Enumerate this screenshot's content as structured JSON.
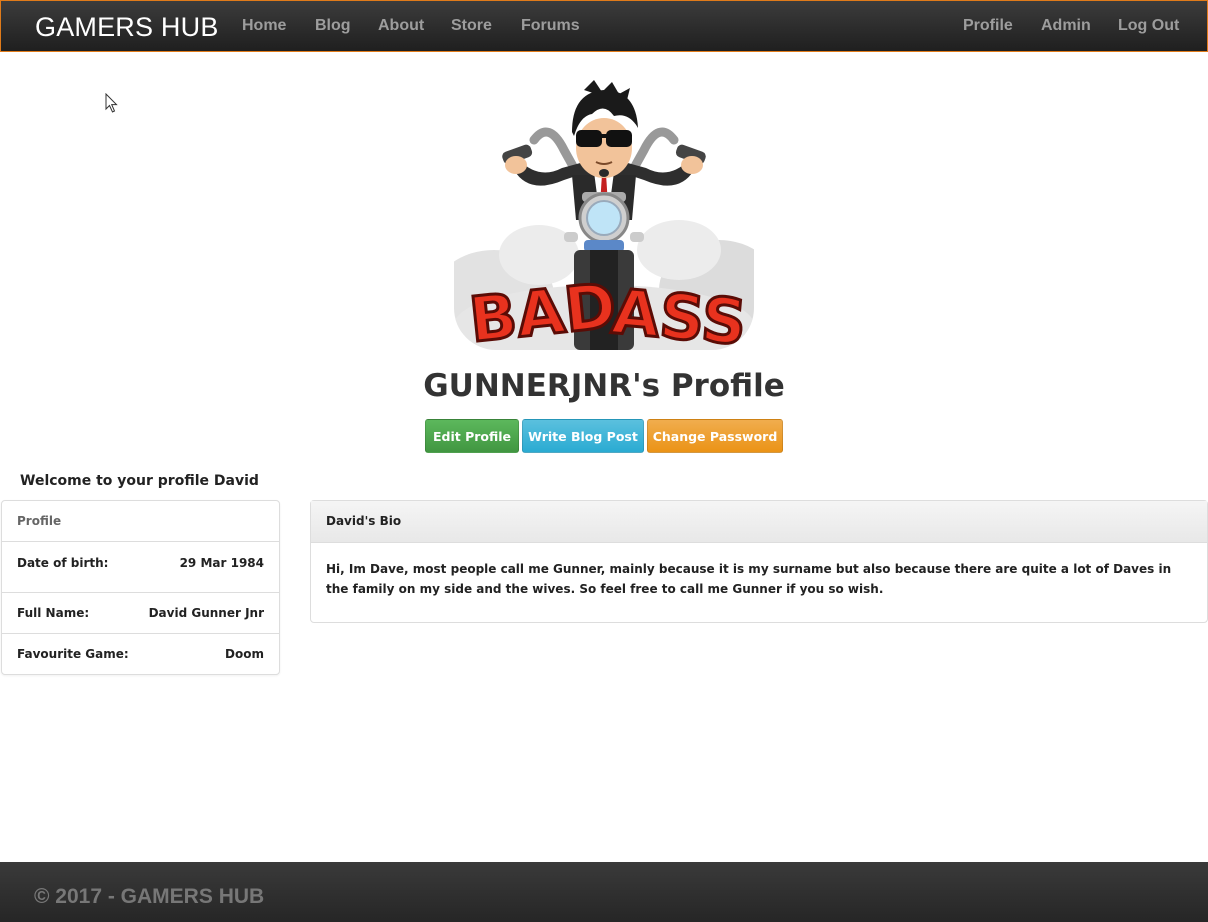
{
  "navbar": {
    "brand": "GAMERS HUB",
    "left_links": [
      "Home",
      "Blog",
      "About",
      "Store",
      "Forums"
    ],
    "right_links": [
      "Profile",
      "Admin",
      "Log Out"
    ],
    "accent_color": "#e07b1a"
  },
  "hero": {
    "avatar_icon": "biker-avatar-icon",
    "avatar_text": "BAD ASS",
    "title": "GUNNERJNR's Profile",
    "buttons": {
      "edit": "Edit Profile",
      "blog": "Write Blog Post",
      "password": "Change Password"
    }
  },
  "welcome": "Welcome to your profile David",
  "profile_card": {
    "heading": "Profile",
    "rows": [
      {
        "label": "Date of birth:",
        "value": "29 Mar 1984"
      },
      {
        "label": "Full Name:",
        "value": "David Gunner Jnr"
      },
      {
        "label": "Favourite Game:",
        "value": "Doom"
      }
    ]
  },
  "bio": {
    "heading": "David's Bio",
    "text": "Hi, Im Dave, most people call me Gunner, mainly because it is my surname but also because there are quite a lot of Daves in the family on my side and the wives. So feel free to call me Gunner if you so wish."
  },
  "footer": {
    "text": "© 2017 - GAMERS HUB"
  },
  "colors": {
    "success": "#5cb85c",
    "info": "#5bc0de",
    "warning": "#f0ad4e"
  }
}
